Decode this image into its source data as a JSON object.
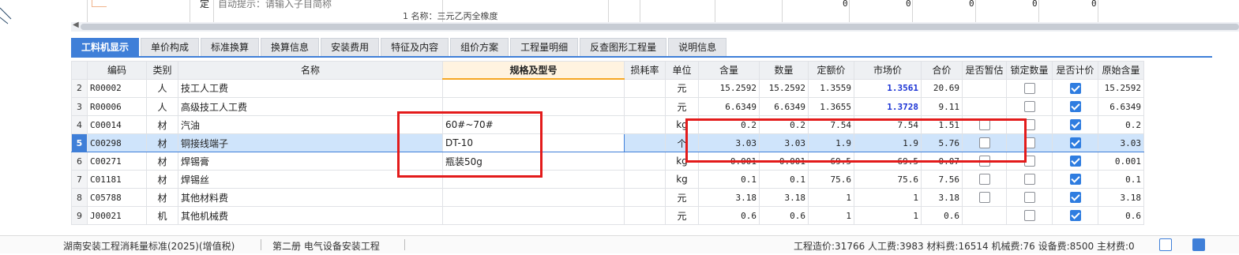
{
  "top_row": {
    "col_label": "定",
    "hint": "自动提示：请输入子目简称",
    "values": [
      "0",
      "0",
      "0",
      "0",
      "0"
    ],
    "next_row_partial": "1 名称：三元乙丙全橡度"
  },
  "tabs": [
    {
      "label": "工料机显示",
      "active": true
    },
    {
      "label": "单价构成",
      "active": false
    },
    {
      "label": "标准换算",
      "active": false
    },
    {
      "label": "换算信息",
      "active": false
    },
    {
      "label": "安装费用",
      "active": false
    },
    {
      "label": "特征及内容",
      "active": false
    },
    {
      "label": "组价方案",
      "active": false
    },
    {
      "label": "工程量明细",
      "active": false
    },
    {
      "label": "反查图形工程量",
      "active": false
    },
    {
      "label": "说明信息",
      "active": false
    }
  ],
  "columns": [
    "编码",
    "类别",
    "名称",
    "规格及型号",
    "损耗率",
    "单位",
    "含量",
    "数量",
    "定额价",
    "市场价",
    "合价",
    "是否暂估",
    "锁定数量",
    "是否计价",
    "原始含量"
  ],
  "rows": [
    {
      "no": "2",
      "code": "R00002",
      "type": "人",
      "name": "技工人工费",
      "spec": "",
      "loss": "",
      "unit": "元",
      "content": "15.2592",
      "qty": "15.2592",
      "quota_price": "1.3559",
      "market_price": "1.3561",
      "market_blue": true,
      "total": "20.69",
      "temp_est": null,
      "lock_qty": false,
      "priced": true,
      "orig_content": "15.2592"
    },
    {
      "no": "3",
      "code": "R00006",
      "type": "人",
      "name": "高级技工人工费",
      "spec": "",
      "loss": "",
      "unit": "元",
      "content": "6.6349",
      "qty": "6.6349",
      "quota_price": "1.3655",
      "market_price": "1.3728",
      "market_blue": true,
      "total": "9.11",
      "temp_est": null,
      "lock_qty": false,
      "priced": true,
      "orig_content": "6.6349"
    },
    {
      "no": "4",
      "code": "C00014",
      "type": "材",
      "name": "汽油",
      "spec": "60#~70#",
      "loss": "",
      "unit": "kg",
      "content": "0.2",
      "qty": "0.2",
      "quota_price": "7.54",
      "market_price": "7.54",
      "market_blue": false,
      "total": "1.51",
      "temp_est": false,
      "lock_qty": false,
      "priced": true,
      "orig_content": "0.2"
    },
    {
      "no": "5",
      "code": "C00298",
      "type": "材",
      "name": "铜接线端子",
      "spec": "DT-10",
      "loss": "",
      "unit": "个",
      "content": "3.03",
      "qty": "3.03",
      "quota_price": "1.9",
      "market_price": "1.9",
      "market_blue": false,
      "total": "5.76",
      "temp_est": false,
      "lock_qty": false,
      "priced": true,
      "orig_content": "3.03",
      "selected": true
    },
    {
      "no": "6",
      "code": "C00271",
      "type": "材",
      "name": "焊锡膏",
      "spec": "瓶装50g",
      "loss": "",
      "unit": "kg",
      "content": "0.001",
      "qty": "0.001",
      "quota_price": "69.5",
      "market_price": "69.5",
      "market_blue": false,
      "total": "0.07",
      "temp_est": false,
      "lock_qty": false,
      "priced": true,
      "orig_content": "0.001"
    },
    {
      "no": "7",
      "code": "C01181",
      "type": "材",
      "name": "焊锡丝",
      "spec": "",
      "loss": "",
      "unit": "kg",
      "content": "0.1",
      "qty": "0.1",
      "quota_price": "75.6",
      "market_price": "75.6",
      "market_blue": false,
      "total": "7.56",
      "temp_est": false,
      "lock_qty": false,
      "priced": true,
      "orig_content": "0.1"
    },
    {
      "no": "8",
      "code": "C05788",
      "type": "材",
      "name": "其他材料费",
      "spec": "",
      "loss": "",
      "unit": "元",
      "content": "3.18",
      "qty": "3.18",
      "quota_price": "1",
      "market_price": "1",
      "market_blue": false,
      "total": "3.18",
      "temp_est": false,
      "lock_qty": false,
      "priced": true,
      "orig_content": "3.18"
    },
    {
      "no": "9",
      "code": "J00021",
      "type": "机",
      "name": "其他机械费",
      "spec": "",
      "loss": "",
      "unit": "元",
      "content": "0.6",
      "qty": "0.6",
      "quota_price": "1",
      "market_price": "1",
      "market_blue": false,
      "total": "0.6",
      "temp_est": null,
      "lock_qty": false,
      "priced": true,
      "orig_content": "0.6"
    }
  ],
  "status_bar": {
    "left": "湖南安装工程消耗量标准(2025)(增值税)",
    "middle": "第二册 电气设备安装工程",
    "right": "工程造价:31766  人工费:3983  材料费:16514  机械费:76  设备费:8500  主材费:0"
  },
  "colors": {
    "accent": "#3f7fd8",
    "annotation_red": "#e31b1b",
    "price_blue": "#1a32d4"
  }
}
